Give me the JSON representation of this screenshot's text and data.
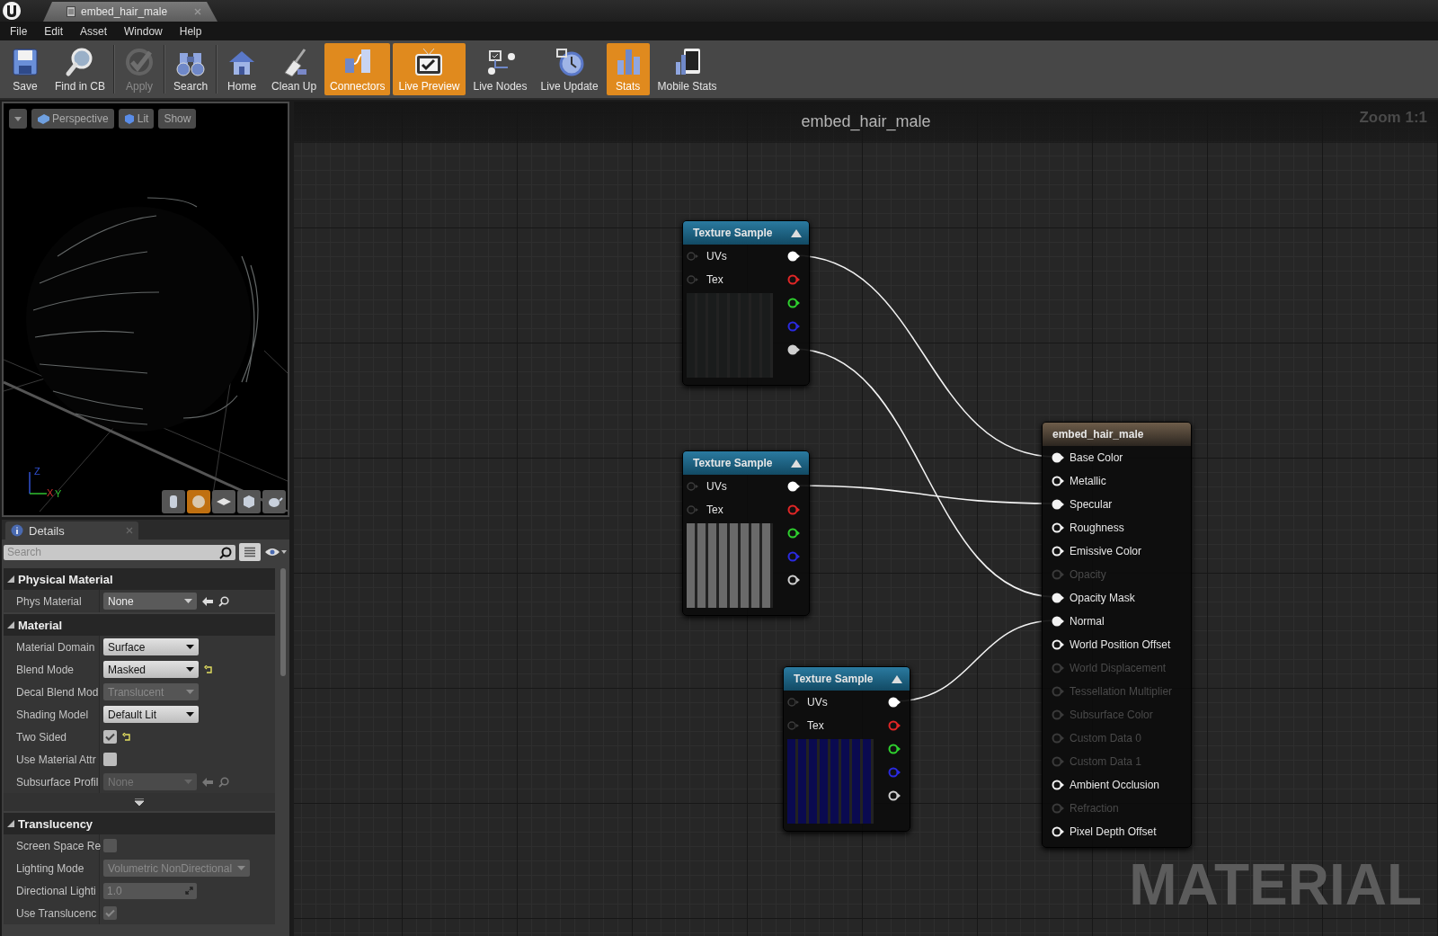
{
  "window": {
    "tab_title": "embed_hair_male"
  },
  "menu": [
    "File",
    "Edit",
    "Asset",
    "Window",
    "Help"
  ],
  "toolbar": [
    {
      "label": "Save",
      "active": false,
      "disabled": false,
      "separator_before": false
    },
    {
      "label": "Find in CB",
      "active": false,
      "disabled": false,
      "separator_before": false
    },
    {
      "label": "Apply",
      "active": false,
      "disabled": true,
      "separator_before": true
    },
    {
      "label": "Search",
      "active": false,
      "disabled": false,
      "separator_before": true
    },
    {
      "label": "Home",
      "active": false,
      "disabled": false,
      "separator_before": true
    },
    {
      "label": "Clean Up",
      "active": false,
      "disabled": false,
      "separator_before": false
    },
    {
      "label": "Connectors",
      "active": true,
      "disabled": false,
      "separator_before": false
    },
    {
      "label": "Live Preview",
      "active": true,
      "disabled": false,
      "separator_before": false
    },
    {
      "label": "Live Nodes",
      "active": false,
      "disabled": false,
      "separator_before": false
    },
    {
      "label": "Live Update",
      "active": false,
      "disabled": false,
      "separator_before": false
    },
    {
      "label": "Stats",
      "active": true,
      "disabled": false,
      "separator_before": false
    },
    {
      "label": "Mobile Stats",
      "active": false,
      "disabled": false,
      "separator_before": false
    }
  ],
  "viewport": {
    "view_buttons": [
      "Perspective",
      "Lit",
      "Show"
    ],
    "axis_labels": [
      "Z",
      "X",
      "Y"
    ],
    "shape_buttons": [
      {
        "selected": false
      },
      {
        "selected": true
      },
      {
        "selected": false
      },
      {
        "selected": false
      },
      {
        "selected": false
      }
    ]
  },
  "details": {
    "tab": "Details",
    "search": {
      "placeholder": "Search"
    },
    "sections": [
      {
        "title": "Physical Material",
        "expanded": true,
        "advanced_toggle": false,
        "rows": [
          {
            "kind": "asset",
            "label": "Phys Material",
            "value": "None",
            "disabled": false
          }
        ]
      },
      {
        "title": "Material",
        "expanded": true,
        "advanced_toggle": true,
        "rows": [
          {
            "kind": "dropdown",
            "label": "Material Domain",
            "value": "Surface",
            "disabled": false,
            "modified": false
          },
          {
            "kind": "dropdown",
            "label": "Blend Mode",
            "value": "Masked",
            "disabled": false,
            "modified": true
          },
          {
            "kind": "dropdown",
            "label": "Decal Blend Mod",
            "value": "Translucent",
            "disabled": true,
            "modified": false
          },
          {
            "kind": "dropdown",
            "label": "Shading Model",
            "value": "Default Lit",
            "disabled": false,
            "modified": false
          },
          {
            "kind": "checkbox",
            "label": "Two Sided",
            "checked": true,
            "disabled": false,
            "modified": true
          },
          {
            "kind": "checkbox",
            "label": "Use Material Attr",
            "checked": false,
            "disabled": false,
            "modified": false
          },
          {
            "kind": "asset",
            "label": "Subsurface Profil",
            "value": "None",
            "disabled": true
          }
        ]
      },
      {
        "title": "Translucency",
        "expanded": true,
        "advanced_toggle": false,
        "rows": [
          {
            "kind": "checkbox",
            "label": "Screen Space Re",
            "checked": false,
            "disabled": true,
            "modified": false
          },
          {
            "kind": "dropdown",
            "label": "Lighting Mode",
            "value": "Volumetric NonDirectional",
            "disabled": true,
            "modified": false
          },
          {
            "kind": "number",
            "label": "Directional Lighti",
            "value": "1.0",
            "disabled": true
          },
          {
            "kind": "checkbox",
            "label": "Use Translucenc",
            "checked": true,
            "disabled": true,
            "modified": false
          }
        ]
      }
    ]
  },
  "graph": {
    "title": "embed_hair_male",
    "zoom": "Zoom 1:1",
    "graph_type": "MATERIAL",
    "texture_nodes": [
      {
        "title": "Texture Sample",
        "inputs": [
          "UVs",
          "Tex"
        ],
        "outputs": [
          {
            "color": "#ffffff",
            "connected": true
          },
          {
            "color": "#e02626",
            "connected": false
          },
          {
            "color": "#2ed02e",
            "connected": false
          },
          {
            "color": "#2a2ae0",
            "connected": false
          },
          {
            "color": "#cfcfcf",
            "connected": true
          }
        ]
      },
      {
        "title": "Texture Sample",
        "inputs": [
          "UVs",
          "Tex"
        ],
        "outputs": [
          {
            "color": "#ffffff",
            "connected": true
          },
          {
            "color": "#e02626",
            "connected": false
          },
          {
            "color": "#2ed02e",
            "connected": false
          },
          {
            "color": "#2a2ae0",
            "connected": false
          },
          {
            "color": "#cfcfcf",
            "connected": false
          }
        ]
      },
      {
        "title": "Texture Sample",
        "inputs": [
          "UVs",
          "Tex"
        ],
        "outputs": [
          {
            "color": "#ffffff",
            "connected": true
          },
          {
            "color": "#e02626",
            "connected": false
          },
          {
            "color": "#2ed02e",
            "connected": false
          },
          {
            "color": "#2a2ae0",
            "connected": false
          },
          {
            "color": "#cfcfcf",
            "connected": false
          }
        ]
      }
    ],
    "material_node": {
      "title": "embed_hair_male",
      "inputs": [
        {
          "label": "Base Color",
          "enabled": true,
          "connected": true
        },
        {
          "label": "Metallic",
          "enabled": true,
          "connected": false
        },
        {
          "label": "Specular",
          "enabled": true,
          "connected": true
        },
        {
          "label": "Roughness",
          "enabled": true,
          "connected": false
        },
        {
          "label": "Emissive Color",
          "enabled": true,
          "connected": false
        },
        {
          "label": "Opacity",
          "enabled": false,
          "connected": false
        },
        {
          "label": "Opacity Mask",
          "enabled": true,
          "connected": true
        },
        {
          "label": "Normal",
          "enabled": true,
          "connected": true
        },
        {
          "label": "World Position Offset",
          "enabled": true,
          "connected": false
        },
        {
          "label": "World Displacement",
          "enabled": false,
          "connected": false
        },
        {
          "label": "Tessellation Multiplier",
          "enabled": false,
          "connected": false
        },
        {
          "label": "Subsurface Color",
          "enabled": false,
          "connected": false
        },
        {
          "label": "Custom Data 0",
          "enabled": false,
          "connected": false
        },
        {
          "label": "Custom Data 1",
          "enabled": false,
          "connected": false
        },
        {
          "label": "Ambient Occlusion",
          "enabled": true,
          "connected": false
        },
        {
          "label": "Refraction",
          "enabled": false,
          "connected": false
        },
        {
          "label": "Pixel Depth Offset",
          "enabled": true,
          "connected": false
        }
      ]
    }
  }
}
